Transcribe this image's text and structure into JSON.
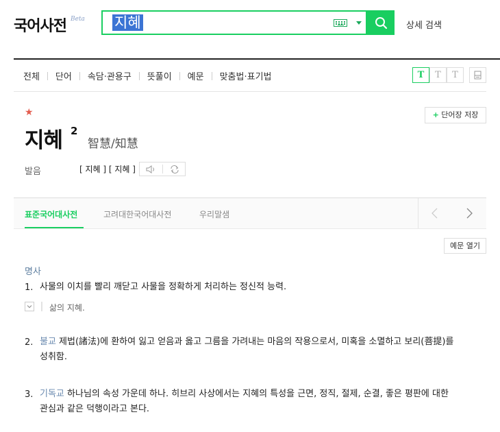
{
  "header": {
    "logo": "국어사전",
    "beta": "Beta",
    "search_value": "지혜",
    "advanced_search": "상세 검색"
  },
  "nav": {
    "items": [
      "전체",
      "단어",
      "속담·관용구",
      "뜻풀이",
      "예문",
      "맞춤법·표기법"
    ]
  },
  "font_buttons": [
    "T",
    "T",
    "T"
  ],
  "entry": {
    "headword": "지혜",
    "homonym_number": "2",
    "hanja": "智慧/知慧",
    "add_wordbook": "단어장 저장",
    "pronunciation_label": "발음",
    "pronunciation": "[ 지혜 ] [ 지혜 ]"
  },
  "dict_tabs": [
    "표준국어대사전",
    "고려대한국어대사전",
    "우리말샘"
  ],
  "example_open": "예문 열기",
  "definitions": {
    "pos": "명사",
    "items": [
      {
        "num": "1.",
        "field": "",
        "text": "사물의 이치를 빨리 깨닫고 사물을 정확하게 처리하는 정신적 능력.",
        "example": "삶의 지혜."
      },
      {
        "num": "2.",
        "field": "불교",
        "text_line1": " 제법(諸法)에 환하여 잃고 얻음과 옳고 그름을 가려내는 마음의 작용으로서, 미혹을 소멸하고 보리(菩提)를",
        "text_line2": "성취함."
      },
      {
        "num": "3.",
        "field": "기독교",
        "text_line1": " 하나님의 속성 가운데 하나. 히브리 사상에서는 지혜의 특성을 근면, 정직, 절제, 순결, 좋은 평판에 대한",
        "text_line2": "관심과 같은 덕행이라고 본다."
      }
    ]
  },
  "colors": {
    "accent": "#19ce60",
    "star": "#e35d4f",
    "selection": "#3b74d4"
  }
}
